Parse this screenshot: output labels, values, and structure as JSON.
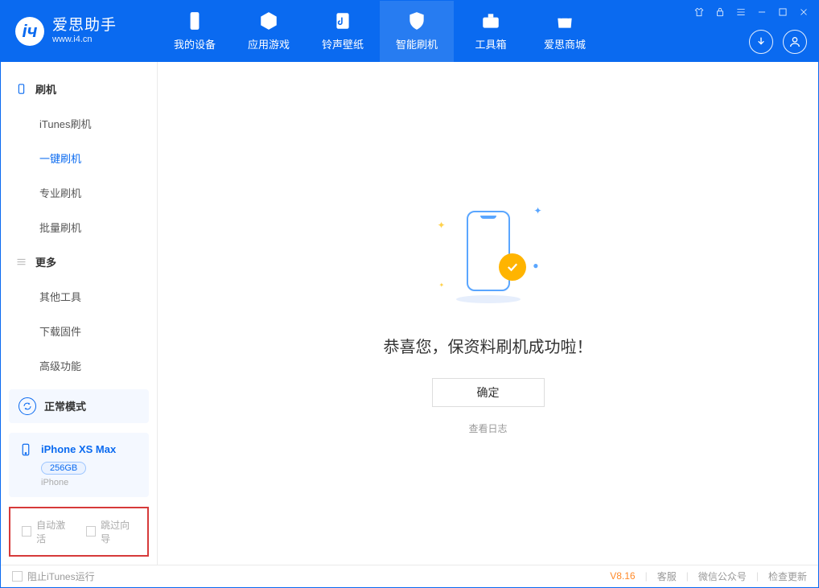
{
  "app": {
    "title": "爱思助手",
    "subtitle": "www.i4.cn"
  },
  "nav": {
    "tabs": [
      {
        "label": "我的设备"
      },
      {
        "label": "应用游戏"
      },
      {
        "label": "铃声壁纸"
      },
      {
        "label": "智能刷机"
      },
      {
        "label": "工具箱"
      },
      {
        "label": "爱思商城"
      }
    ]
  },
  "sidebar": {
    "group_flash": "刷机",
    "items_flash": [
      {
        "label": "iTunes刷机"
      },
      {
        "label": "一键刷机"
      },
      {
        "label": "专业刷机"
      },
      {
        "label": "批量刷机"
      }
    ],
    "group_more": "更多",
    "items_more": [
      {
        "label": "其他工具"
      },
      {
        "label": "下载固件"
      },
      {
        "label": "高级功能"
      }
    ],
    "mode_label": "正常模式",
    "device": {
      "name": "iPhone XS Max",
      "storage": "256GB",
      "type": "iPhone"
    },
    "checkbox_auto_activate": "自动激活",
    "checkbox_skip_guide": "跳过向导"
  },
  "main": {
    "success_text": "恭喜您，保资料刷机成功啦！",
    "ok_button": "确定",
    "view_log": "查看日志"
  },
  "footer": {
    "block_itunes": "阻止iTunes运行",
    "version": "V8.16",
    "link_service": "客服",
    "link_wechat": "微信公众号",
    "link_update": "检查更新"
  }
}
